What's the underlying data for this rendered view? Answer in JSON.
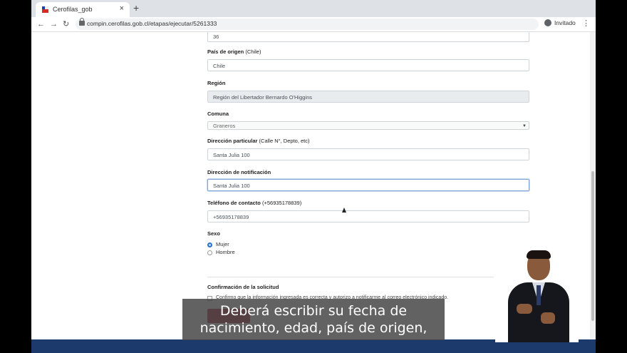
{
  "browser": {
    "tab_title": "Cerofilas_gob",
    "tab_close": "×",
    "new_tab": "+",
    "url": "compin.cerofilas.gob.cl/etapas/ejecutar/5261333",
    "profile": "Invitado",
    "menu": "⋮",
    "back": "←",
    "forward": "→",
    "reload": "↻"
  },
  "form": {
    "age_value": "36",
    "origin_label": "País de origen",
    "origin_hint": "(Chile)",
    "origin_value": "Chile",
    "region_label": "Región",
    "region_value": "Región del Libertador Bernardo O'Higgins",
    "comuna_label": "Comuna",
    "comuna_value": "Graneros",
    "address_label": "Dirección particular",
    "address_hint": "(Calle N°, Depto, etc)",
    "address_value": "Santa Julia 100",
    "notify_label": "Dirección de notificación",
    "notify_value": "Santa Julia 100",
    "phone_label": "Teléfono de contacto",
    "phone_hint": "(+56935178839)",
    "phone_value": "+56935178839",
    "sex_label": "Sexo",
    "sex_options": [
      "Mujer",
      "Hombre"
    ],
    "confirm_title": "Confirmación de la solicitud",
    "confirm_text": "Confirmo que la información ingresada es correcta y autorizo a notificarme al correo electrónico indicado."
  },
  "caption": {
    "line1": "Deberá escribir su fecha de",
    "line2": "nacimiento, edad, país de origen,"
  }
}
